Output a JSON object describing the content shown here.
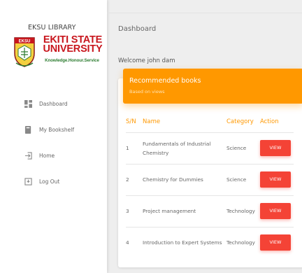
{
  "sidebar": {
    "library_title": "EKSU LIBRARY",
    "university_line1": "EKITI STATE",
    "university_line2": "UNIVERSITY",
    "motto": "Knowledge.Honour.Service",
    "logo_text": "EKSU",
    "nav": [
      {
        "label": "Dashboard",
        "icon": "dashboard-icon"
      },
      {
        "label": "My Bookshelf",
        "icon": "book-icon"
      },
      {
        "label": "Home",
        "icon": "enter-icon"
      },
      {
        "label": "Log Out",
        "icon": "logout-icon"
      }
    ]
  },
  "header": {
    "title": "Dashboard"
  },
  "welcome": "Welcome john dam",
  "card": {
    "title": "Recommended books",
    "subtitle": "Based on views",
    "columns": [
      "S/N",
      "Name",
      "Category",
      "Action"
    ],
    "rows": [
      {
        "sn": "1",
        "name": "Fundamentals of Industrial Chemistry",
        "category": "Science",
        "action": "VIEW"
      },
      {
        "sn": "2",
        "name": "Chemistry for Dummies",
        "category": "Science",
        "action": "VIEW"
      },
      {
        "sn": "3",
        "name": "Project management",
        "category": "Technology",
        "action": "VIEW"
      },
      {
        "sn": "4",
        "name": "Introduction to Expert Systems",
        "category": "Technology",
        "action": "VIEW"
      }
    ]
  },
  "colors": {
    "accent": "#ff9800",
    "button": "#f44336",
    "brand_red": "#c8161d",
    "brand_green": "#2e7d32"
  }
}
